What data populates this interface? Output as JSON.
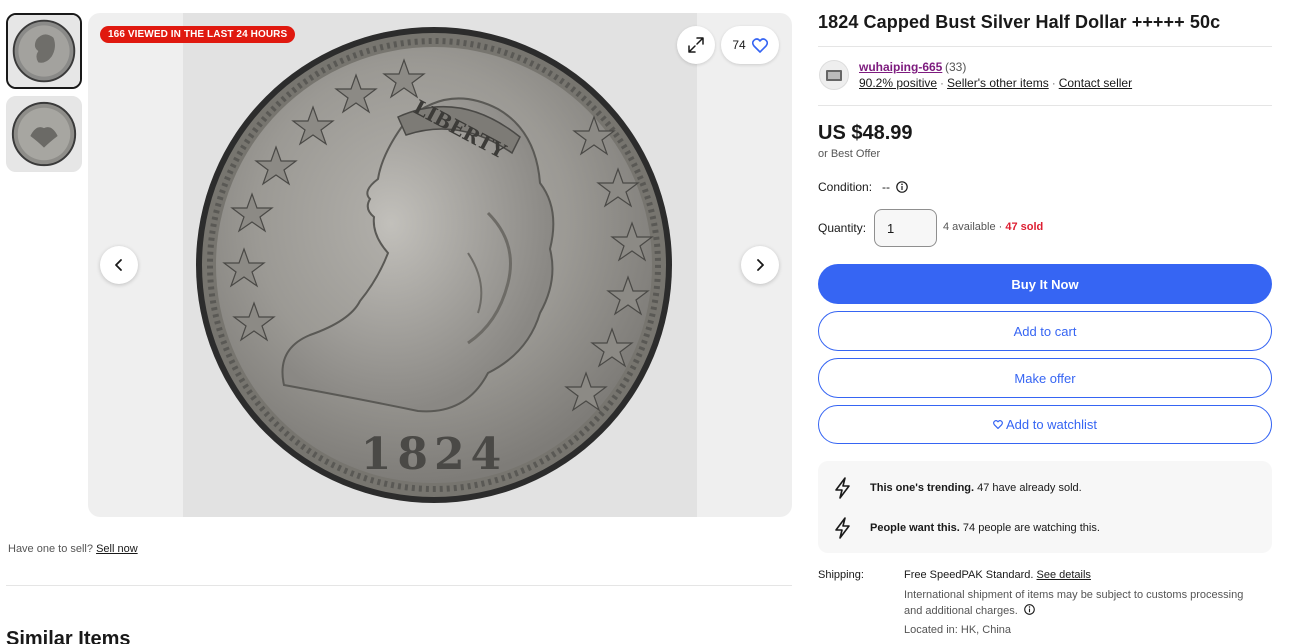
{
  "gallery": {
    "viewed_badge": "166 VIEWED IN THE LAST 24 HOURS",
    "watch_count": "74",
    "coin_year": "1824",
    "coin_legend": "LIBERTY"
  },
  "sell": {
    "prompt": "Have one to sell?",
    "link": "Sell now"
  },
  "similar": {
    "title": "Similar Items"
  },
  "item": {
    "title": "1824 Capped Bust Silver Half Dollar +++++ 50c"
  },
  "seller": {
    "name": "wuhaiping-665",
    "feedback_count": "(33)",
    "positive": "90.2% positive",
    "other_items": "Seller's other items",
    "contact": "Contact seller"
  },
  "price": {
    "amount": "US $48.99",
    "best_offer": "or Best Offer"
  },
  "condition": {
    "label": "Condition:",
    "value": "--"
  },
  "quantity": {
    "label": "Quantity:",
    "value": "1",
    "available": "4 available",
    "sold": "47 sold"
  },
  "buttons": {
    "buy_now": "Buy It Now",
    "add_to_cart": "Add to cart",
    "make_offer": "Make offer",
    "watchlist": "Add to watchlist"
  },
  "trending": [
    {
      "bold": "This one's trending.",
      "text": " 47 have already sold."
    },
    {
      "bold": "People want this.",
      "text": " 74 people are watching this."
    }
  ],
  "shipping": {
    "label": "Shipping:",
    "method": "Free SpeedPAK Standard.",
    "details_link": "See details",
    "note": "International shipment of items may be subject to customs processing and additional charges.",
    "location": "Located in: HK, China"
  },
  "colors": {
    "primary": "#3665f3",
    "badge": "#e0190f",
    "sold": "#dd1e31",
    "seller_link": "#7d1b7e"
  }
}
